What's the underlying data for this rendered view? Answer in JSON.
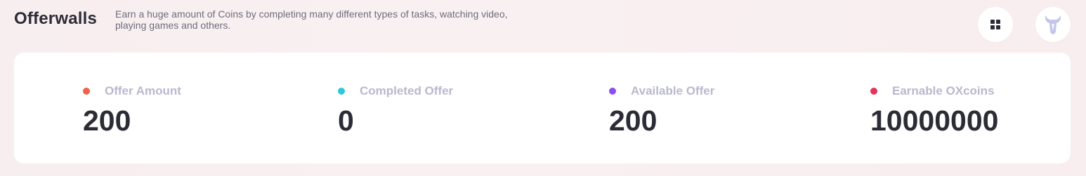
{
  "header": {
    "title": "Offerwalls",
    "description": "Earn a huge amount of Coins by completing many different types of tasks, watching video, playing games and others.",
    "grid_icon": "grid-icon",
    "logo_icon": "bull-logo-icon"
  },
  "stats": [
    {
      "label": "Offer Amount",
      "value": "200",
      "dot_color": "#f0604c"
    },
    {
      "label": "Completed Offer",
      "value": "0",
      "dot_color": "#2ec8d8"
    },
    {
      "label": "Available Offer",
      "value": "200",
      "dot_color": "#8a4ff0"
    },
    {
      "label": "Earnable OXcoins",
      "value": "10000000",
      "dot_color": "#e6335a"
    }
  ],
  "colors": {
    "text_dark": "#2c2c37",
    "label_muted": "#b9b8cf",
    "logo": "#c3c6ea"
  }
}
